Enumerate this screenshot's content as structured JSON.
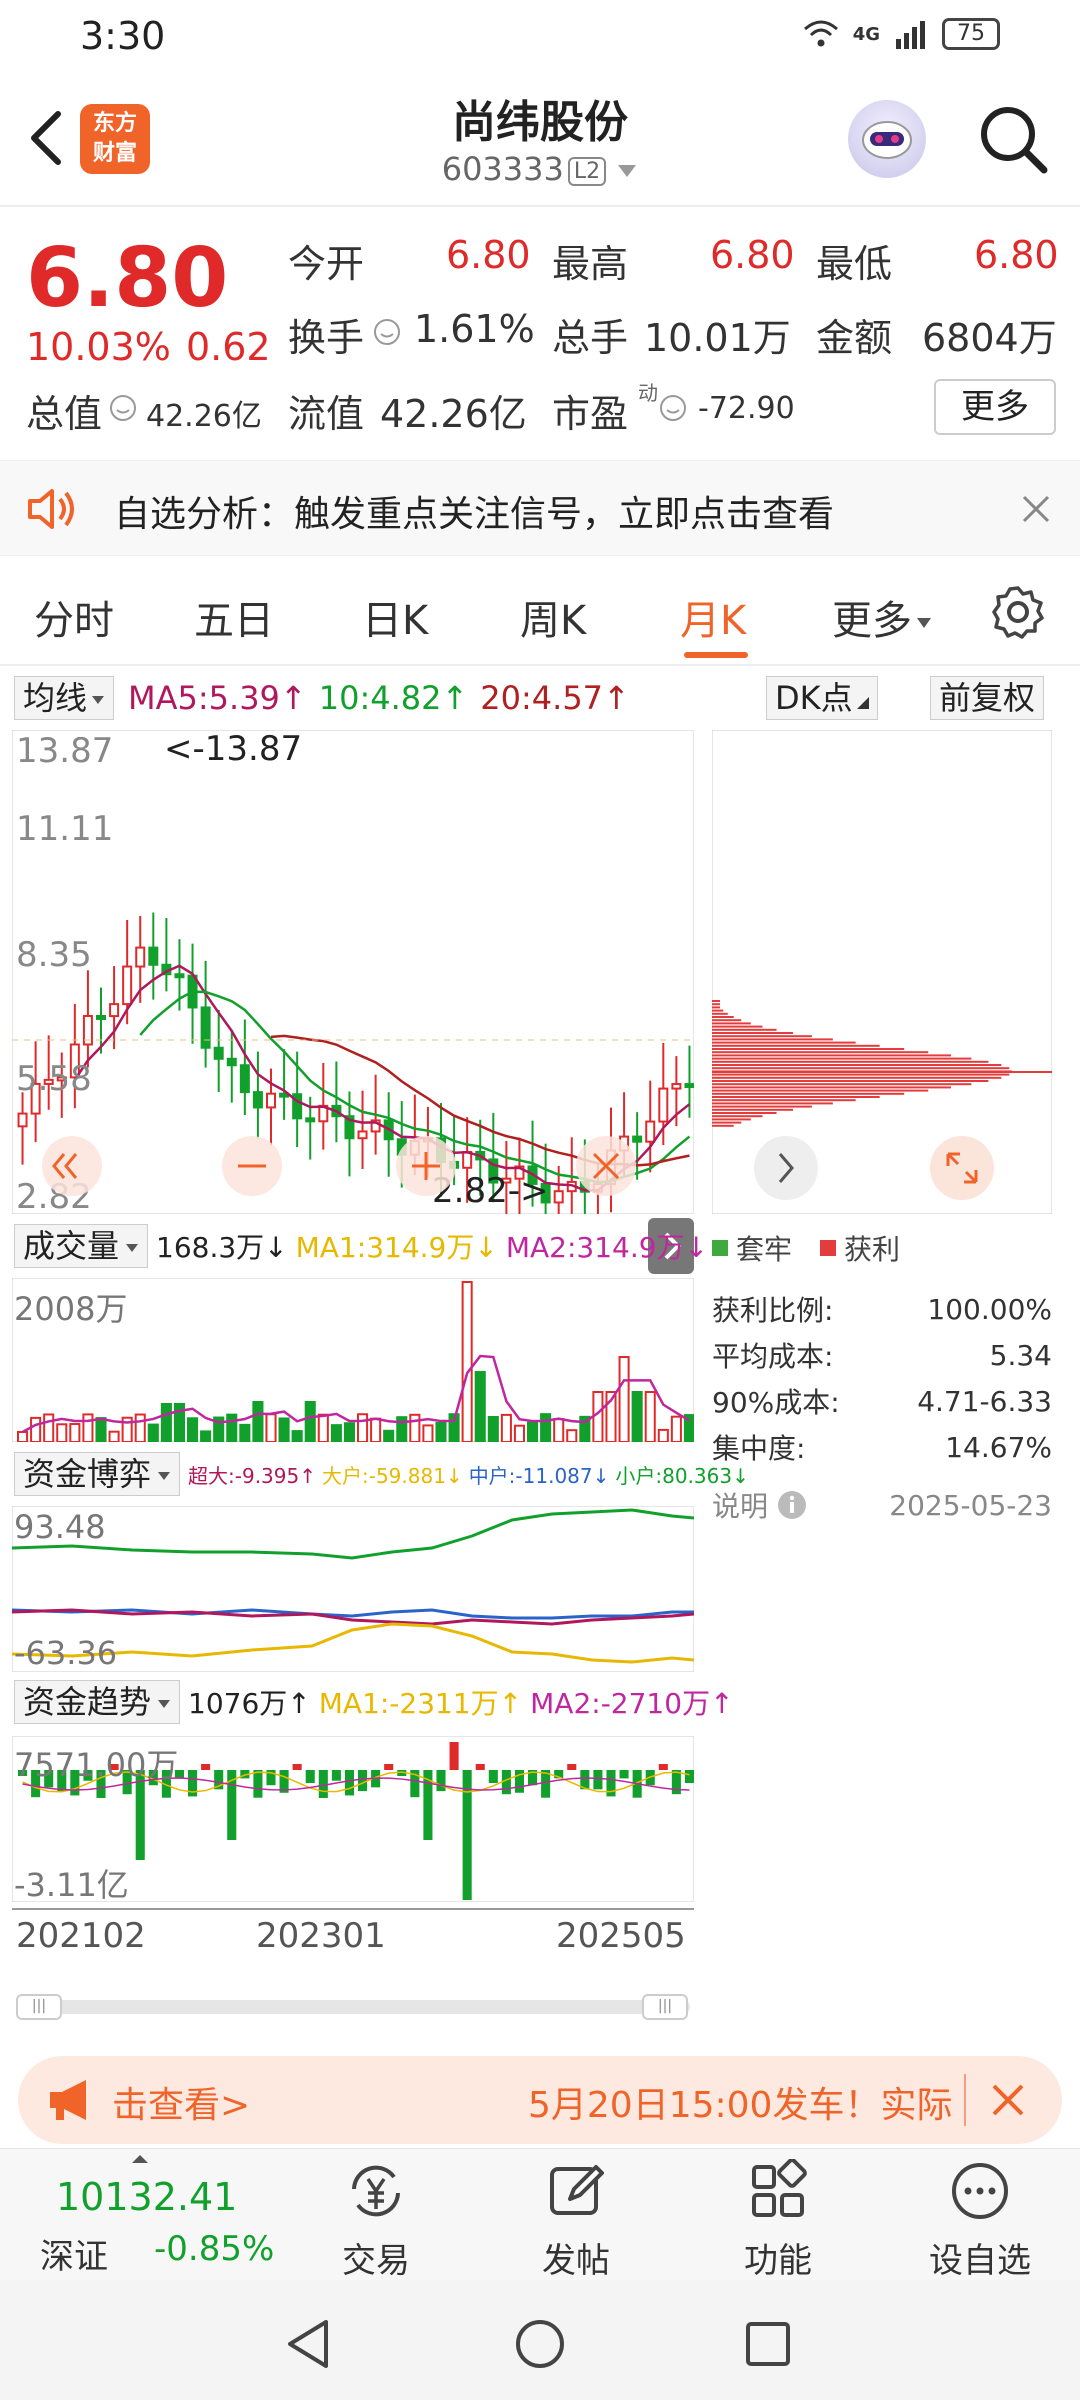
{
  "status": {
    "time": "3:30",
    "network": "4G",
    "battery": "75"
  },
  "header": {
    "logo_line1": "东方",
    "logo_line2": "财富",
    "title": "尚纬股份",
    "code": "603333",
    "level": "L2"
  },
  "quote": {
    "price": "6.80",
    "change_pct": "10.03%",
    "change": "0.62",
    "fields": [
      {
        "label": "今开",
        "value": "6.80"
      },
      {
        "label": "最高",
        "value": "6.80"
      },
      {
        "label": "最低",
        "value": "6.80"
      },
      {
        "label": "换手",
        "value": "1.61%"
      },
      {
        "label": "总手",
        "value": "10.01万"
      },
      {
        "label": "金额",
        "value": "6804万"
      },
      {
        "label": "总值",
        "value": "42.26亿"
      },
      {
        "label": "流值",
        "value": "42.26亿"
      },
      {
        "label": "市盈",
        "value": "-72.90"
      }
    ],
    "pe_superscript": "动",
    "more_label": "更多"
  },
  "alert": {
    "text": "自选分析：触发重点关注信号，立即点击查看"
  },
  "tabs": [
    "分时",
    "五日",
    "日K",
    "周K",
    "月K",
    "更多"
  ],
  "active_tab": "月K",
  "kline": {
    "indicator_select": "均线",
    "ma5": "MA5:5.39↑",
    "ma10": "10:4.82↑",
    "ma20": "20:4.57↑",
    "dk_btn": "DK点",
    "fuquan_btn": "前复权",
    "y_labels": [
      "13.87",
      "11.11",
      "8.35",
      "5.58",
      "2.82"
    ],
    "high_marker": "<-13.87",
    "low_marker": "2.82->",
    "colors": {
      "up": "#e02a2a",
      "down": "#12a02c",
      "ma5": "#b0185e",
      "ma10": "#12a02c",
      "ma20": "#b02020"
    }
  },
  "volume": {
    "select": "成交量",
    "current": "168.3万↓",
    "ma1": "MA1:314.9万↓",
    "ma2": "MA2:314.9万↓",
    "max_label": "2008万"
  },
  "fund_game": {
    "select": "资金博弈",
    "super": "超大:-9.395↑",
    "big": "大户:-59.881↓",
    "mid": "中户:-11.087↓",
    "small": "小户:80.363↓",
    "max_label": "93.48",
    "min_label": "-63.36"
  },
  "fund_trend": {
    "select": "资金趋势",
    "current": "1076万↑",
    "ma1": "MA1:-2311万↑",
    "ma2": "MA2:-2710万↑",
    "max_label": "7571.00万",
    "min_label": "-3.11亿"
  },
  "x_labels": [
    "202102",
    "202301",
    "202505"
  ],
  "chip": {
    "legend_trapped": "套牢",
    "legend_profit": "获利",
    "rows": [
      {
        "label": "获利比例:",
        "value": "100.00%"
      },
      {
        "label": "平均成本:",
        "value": "5.34"
      },
      {
        "label": "90%成本:",
        "value": "4.71-6.33"
      },
      {
        "label": "集中度:",
        "value": "14.67%"
      }
    ],
    "note_label": "说明",
    "date": "2025-05-23"
  },
  "ad": {
    "left_text": "击查看>",
    "right_text": "5月20日15:00发车！实际"
  },
  "bottom_bar": {
    "index_value": "10132.41",
    "index_name": "深证",
    "index_change": "-0.85%",
    "items": [
      "交易",
      "发帖",
      "功能",
      "设自选"
    ]
  }
}
